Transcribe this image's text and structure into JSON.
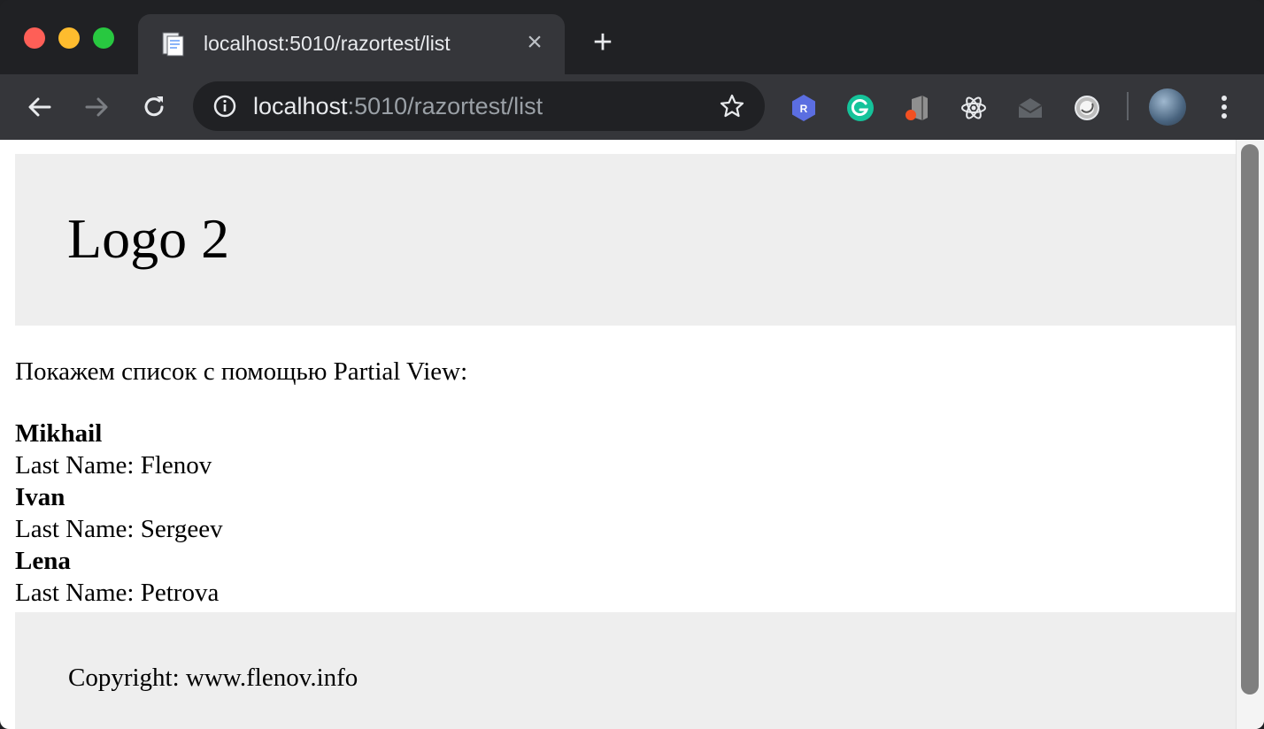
{
  "browser": {
    "tab": {
      "title": "localhost:5010/razortest/list"
    },
    "omnibox": {
      "host": "localhost",
      "path": ":5010/razortest/list"
    },
    "colors": {
      "frame": "#202124",
      "toolbar": "#35363a",
      "omnibox": "#202124"
    },
    "extensions": [
      "r-extension-icon",
      "grammarly-icon",
      "office-icon",
      "react-devtools-icon",
      "mail-icon",
      "circle-extension-icon"
    ]
  },
  "page": {
    "header": {
      "logo_text": "Logo 2"
    },
    "intro_text": "Покажем список с помощью Partial View:",
    "people": [
      {
        "first_name": "Mikhail",
        "last_name_line": "Last Name: Flenov"
      },
      {
        "first_name": "Ivan",
        "last_name_line": "Last Name: Sergeev"
      },
      {
        "first_name": "Lena",
        "last_name_line": "Last Name: Petrova"
      }
    ],
    "footer": {
      "copyright": "Copyright: www.flenov.info"
    },
    "colors": {
      "box_background": "#eeeeee"
    }
  }
}
